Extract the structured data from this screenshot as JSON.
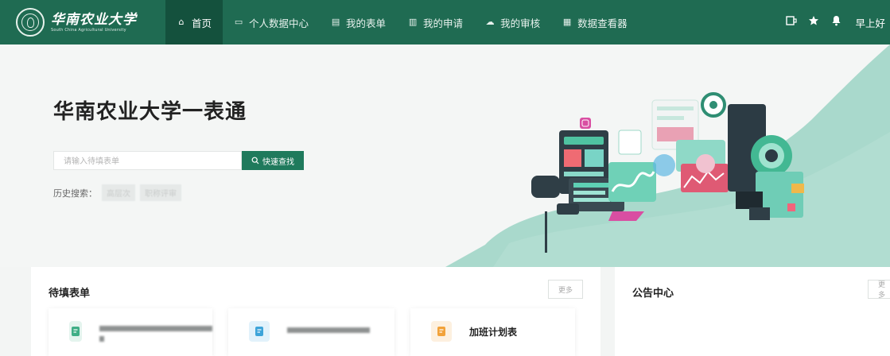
{
  "brand": {
    "name_cn": "华南农业大学",
    "name_en": "South China Agricultural University"
  },
  "nav": {
    "items": [
      {
        "label": "首页",
        "icon": "home-icon",
        "glyph": "⌂",
        "active": true
      },
      {
        "label": "个人数据中心",
        "icon": "monitor-icon",
        "glyph": "▭",
        "active": false
      },
      {
        "label": "我的表单",
        "icon": "document-icon",
        "glyph": "▤",
        "active": false
      },
      {
        "label": "我的申请",
        "icon": "document-icon",
        "glyph": "▥",
        "active": false
      },
      {
        "label": "我的审核",
        "icon": "cloud-icon",
        "glyph": "☁",
        "active": false
      },
      {
        "label": "数据查看器",
        "icon": "table-icon",
        "glyph": "▦",
        "active": false
      }
    ],
    "tools": [
      {
        "icon": "screen-icon",
        "glyph": "▭"
      },
      {
        "icon": "star-icon",
        "glyph": "★"
      },
      {
        "icon": "bell-icon",
        "glyph": "🔔"
      }
    ],
    "greeting": "早上好"
  },
  "hero": {
    "title": "华南农业大学一表通",
    "search_placeholder": "请输入待填表单",
    "search_button": "快速查找",
    "history_label": "历史搜索：",
    "history_tags": [
      "高层次",
      "职称评审"
    ]
  },
  "pending": {
    "title": "待填表单",
    "more": "更多",
    "forms": [
      {
        "name": "",
        "blurred": true,
        "icon_color": "#3fae86"
      },
      {
        "name": "",
        "blurred": true,
        "icon_color": "#3ea4d9"
      },
      {
        "name": "加班计划表",
        "blurred": false,
        "icon_color": "#f2a23a"
      }
    ]
  },
  "notices": {
    "title": "公告中心",
    "more": "更多"
  },
  "colors": {
    "brand": "#1f6b52",
    "nav_active": "#14513d",
    "accent": "#1f7a5c",
    "teal": "#9fd5c5"
  }
}
